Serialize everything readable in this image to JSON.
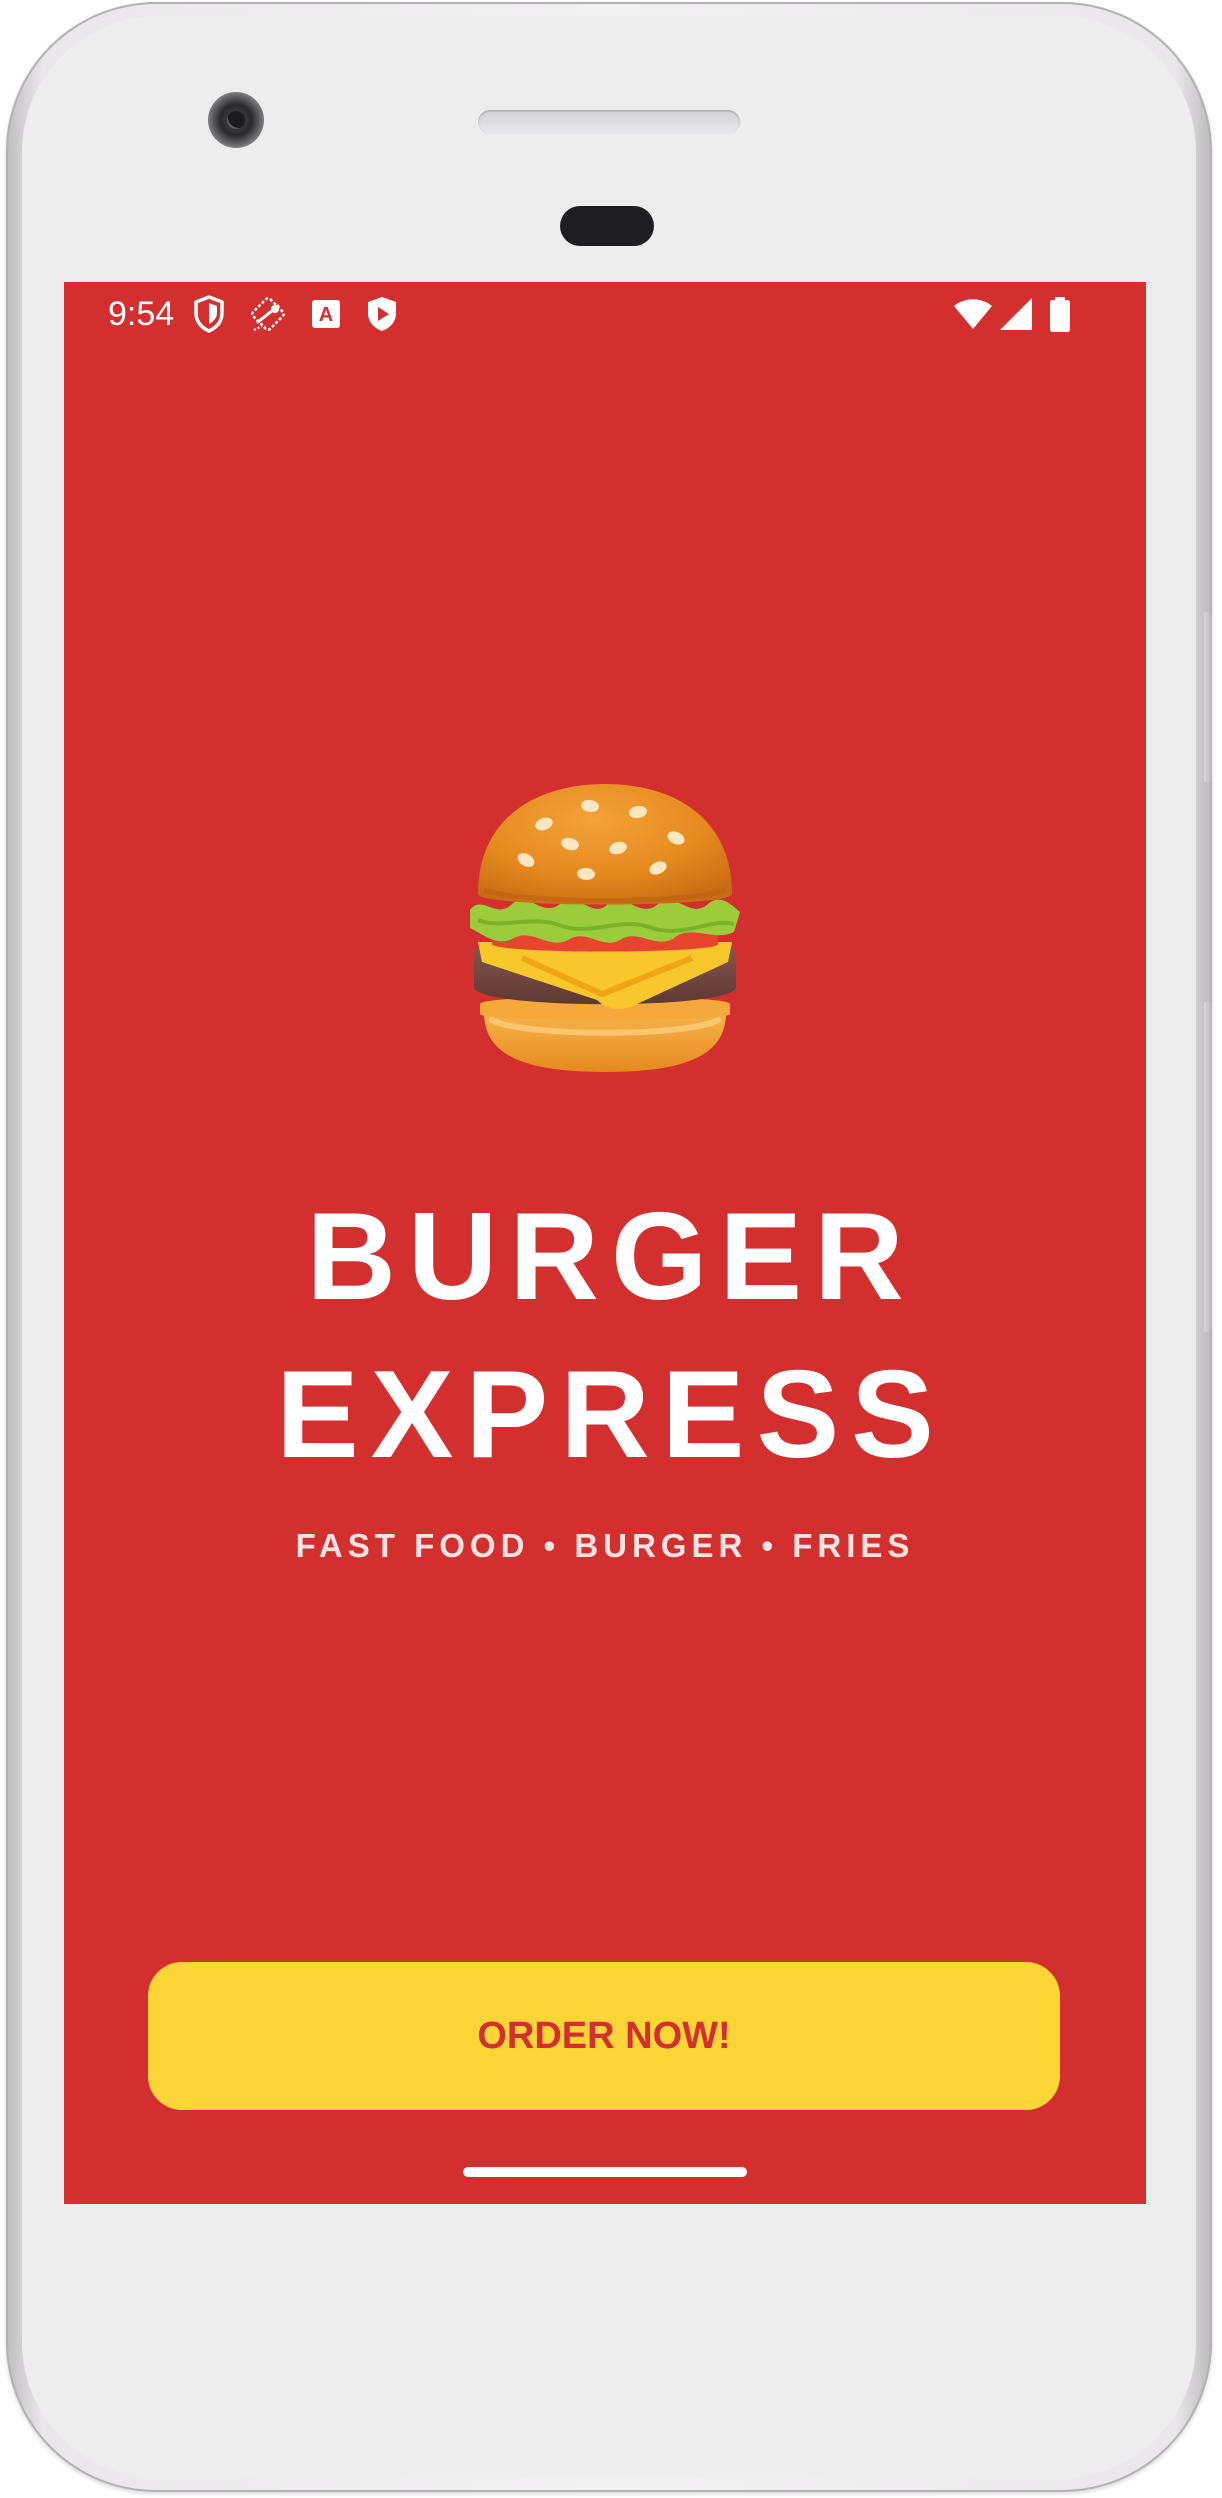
{
  "status_bar": {
    "time": "9:54",
    "left_icons": [
      "shield-icon",
      "tool-icon",
      "text-a-icon",
      "play-shield-icon"
    ],
    "right_icons": [
      "wifi-icon",
      "signal-icon",
      "battery-icon"
    ],
    "a_glyph": "A"
  },
  "splash": {
    "emoji": "hamburger",
    "title_line_1": "BURGER",
    "title_line_2": "EXPRESS",
    "tagline": "FAST FOOD • BURGER • FRIES",
    "cta_label": "ORDER NOW!"
  },
  "colors": {
    "background": "#d32f2f",
    "cta_background": "#fbd535",
    "cta_text": "#d32f2f",
    "text": "#ffffff"
  }
}
